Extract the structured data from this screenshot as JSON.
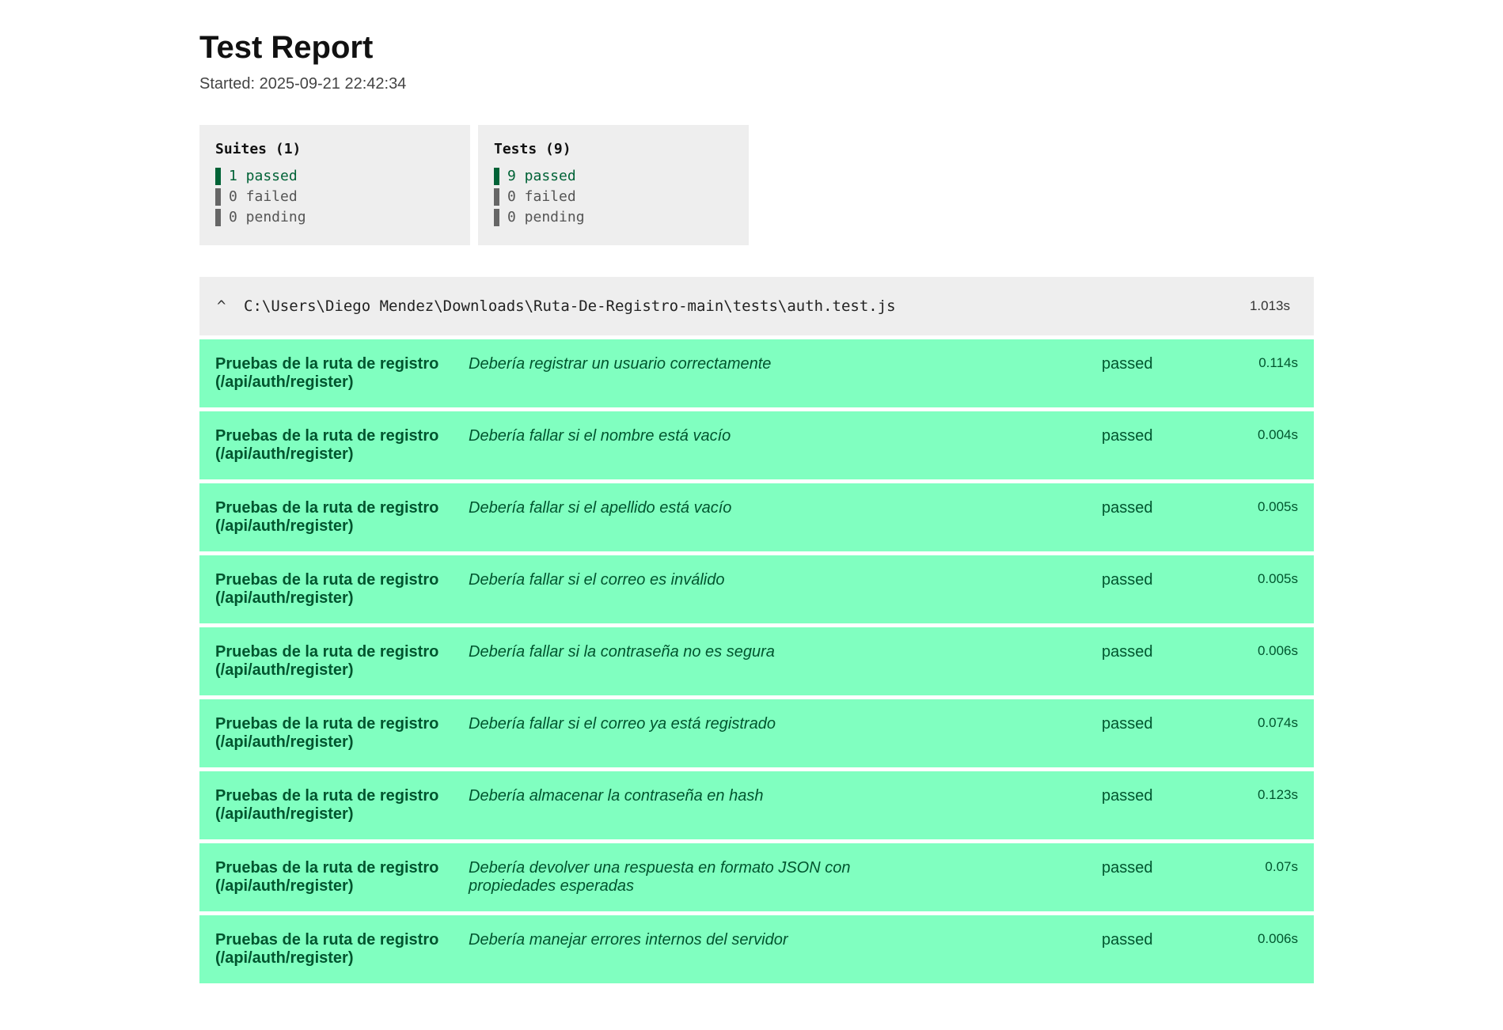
{
  "report": {
    "title": "Test Report",
    "started": "Started: 2025-09-21 22:42:34"
  },
  "summary": {
    "suites": {
      "title": "Suites (1)",
      "passed": "1 passed",
      "failed": "0 failed",
      "pending": "0 pending"
    },
    "tests": {
      "title": "Tests (9)",
      "passed": "9 passed",
      "failed": "0 failed",
      "pending": "0 pending"
    }
  },
  "colors": {
    "passed_bar": "#006236",
    "neutral_bar": "#666666",
    "row_passed_bg": "#80ffc0",
    "row_text": "#00552e",
    "card_bg": "#eeeeee"
  },
  "suite": {
    "caret": "^",
    "caret_icon": "chevron-up-icon",
    "path": "C:\\Users\\Diego Mendez\\Downloads\\Ruta-De-Registro-main\\tests\\auth.test.js",
    "time": "1.013s",
    "tests": [
      {
        "suite": "Pruebas de la ruta de registro (/api/auth/register)",
        "title": "Debería registrar un usuario correctamente",
        "status": "passed",
        "time": "0.114s"
      },
      {
        "suite": "Pruebas de la ruta de registro (/api/auth/register)",
        "title": "Debería fallar si el nombre está vacío",
        "status": "passed",
        "time": "0.004s"
      },
      {
        "suite": "Pruebas de la ruta de registro (/api/auth/register)",
        "title": "Debería fallar si el apellido está vacío",
        "status": "passed",
        "time": "0.005s"
      },
      {
        "suite": "Pruebas de la ruta de registro (/api/auth/register)",
        "title": "Debería fallar si el correo es inválido",
        "status": "passed",
        "time": "0.005s"
      },
      {
        "suite": "Pruebas de la ruta de registro (/api/auth/register)",
        "title": "Debería fallar si la contraseña no es segura",
        "status": "passed",
        "time": "0.006s"
      },
      {
        "suite": "Pruebas de la ruta de registro (/api/auth/register)",
        "title": "Debería fallar si el correo ya está registrado",
        "status": "passed",
        "time": "0.074s"
      },
      {
        "suite": "Pruebas de la ruta de registro (/api/auth/register)",
        "title": "Debería almacenar la contraseña en hash",
        "status": "passed",
        "time": "0.123s"
      },
      {
        "suite": "Pruebas de la ruta de registro (/api/auth/register)",
        "title": "Debería devolver una respuesta en formato JSON con propiedades esperadas",
        "status": "passed",
        "time": "0.07s"
      },
      {
        "suite": "Pruebas de la ruta de registro (/api/auth/register)",
        "title": "Debería manejar errores internos del servidor",
        "status": "passed",
        "time": "0.006s"
      }
    ]
  }
}
